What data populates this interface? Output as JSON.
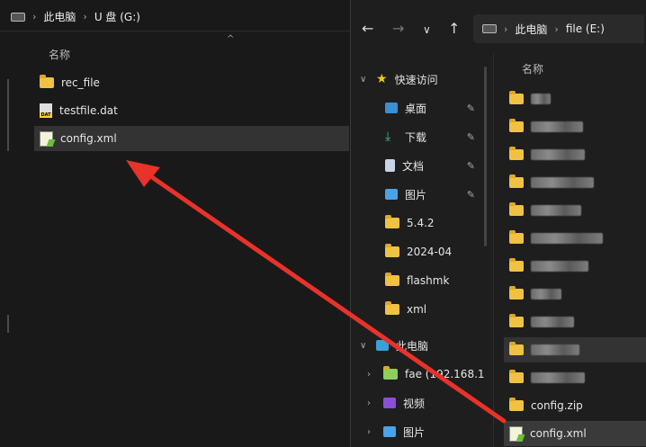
{
  "left_window": {
    "address": [
      "此电脑",
      "U 盘 (G:)"
    ],
    "column_header": "名称",
    "files": [
      {
        "name": "rec_file",
        "type": "folder"
      },
      {
        "name": "testfile.dat",
        "type": "dat"
      },
      {
        "name": "config.xml",
        "type": "xml",
        "selected": true
      }
    ]
  },
  "right_window": {
    "address": [
      "此电脑",
      "file (E:)"
    ],
    "column_header": "名称",
    "quick_access": {
      "label": "快速访问",
      "items": [
        {
          "name": "桌面",
          "icon": "desktop-icon",
          "pinned": true
        },
        {
          "name": "下载",
          "icon": "download-icon",
          "pinned": true
        },
        {
          "name": "文档",
          "icon": "document-icon",
          "pinned": true
        },
        {
          "name": "图片",
          "icon": "picture-icon",
          "pinned": true
        },
        {
          "name": "5.4.2",
          "icon": "folder-icon",
          "pinned": false
        },
        {
          "name": "2024-04",
          "icon": "folder-icon",
          "pinned": false
        },
        {
          "name": "flashmk",
          "icon": "folder-icon",
          "pinned": false
        },
        {
          "name": "xml",
          "icon": "folder-icon",
          "pinned": false
        }
      ]
    },
    "this_pc": {
      "label": "此电脑",
      "items": [
        {
          "name": "fae (192.168.1",
          "icon": "network-folder-icon"
        },
        {
          "name": "视频",
          "icon": "video-icon"
        },
        {
          "name": "图片",
          "icon": "picture-icon"
        }
      ]
    },
    "files_visible": [
      {
        "name": "config.zip",
        "type": "folder"
      },
      {
        "name": "config.xml",
        "type": "xml",
        "selected": true
      }
    ]
  },
  "colors": {
    "arrow": "#e8322a",
    "folder": "#f0c243"
  }
}
